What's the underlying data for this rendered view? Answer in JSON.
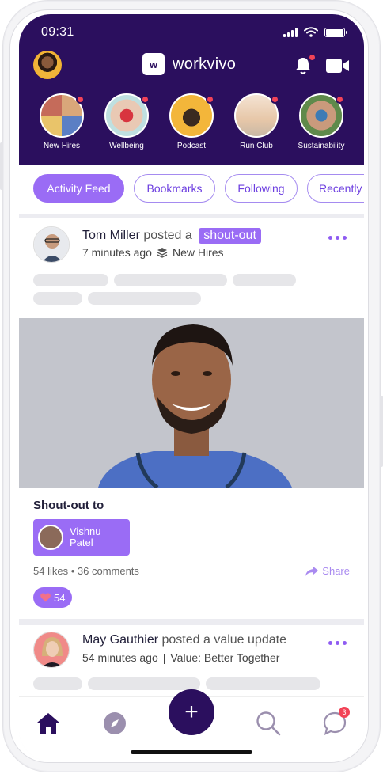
{
  "status_bar": {
    "time": "09:31"
  },
  "app": {
    "logo_mark": "w",
    "name": "workvivo"
  },
  "stories": [
    {
      "label": "New Hires"
    },
    {
      "label": "Wellbeing"
    },
    {
      "label": "Podcast"
    },
    {
      "label": "Run Club"
    },
    {
      "label": "Sustainability"
    }
  ],
  "filters": [
    {
      "label": "Activity Feed",
      "active": true
    },
    {
      "label": "Bookmarks",
      "active": false
    },
    {
      "label": "Following",
      "active": false
    },
    {
      "label": "Recently",
      "active": false
    }
  ],
  "post1": {
    "author": "Tom Miller",
    "action": "posted a",
    "tag": "shout-out",
    "time": "7 minutes ago",
    "space": "New Hires",
    "shout_title": "Shout-out to",
    "recipient_first": "Vishnu",
    "recipient_last": "Patel",
    "likes": "54 likes",
    "comments": "36 comments",
    "share": "Share",
    "reaction_count": "54"
  },
  "post2": {
    "author": "May Gauthier",
    "action": "posted a value update",
    "time": "54 minutes ago",
    "value": "Value: Better Together"
  },
  "nav": {
    "messages_badge": "3",
    "fab": "+"
  },
  "colors": {
    "header": "#2b0f5e",
    "accent": "#9a6cf5",
    "notification": "#f24357"
  },
  "icons": [
    "bell-icon",
    "video-icon",
    "more-icon",
    "stack-icon",
    "share-icon",
    "heart-icon",
    "home-icon",
    "compass-icon",
    "search-icon",
    "chat-icon"
  ]
}
